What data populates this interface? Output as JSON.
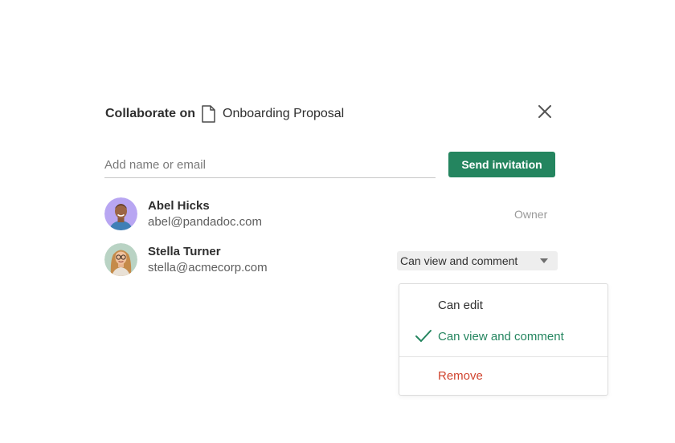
{
  "dialog": {
    "title_prefix": "Collaborate on",
    "document_icon": "document-icon",
    "document_name": "Onboarding Proposal",
    "close_icon": "close-icon"
  },
  "invite": {
    "placeholder": "Add name or email",
    "value": "",
    "send_label": "Send invitation",
    "accent_color": "#24855f"
  },
  "collaborators": [
    {
      "name": "Abel Hicks",
      "email": "abel@pandadoc.com",
      "role": "Owner",
      "avatar_bg": "#b8a6f2"
    },
    {
      "name": "Stella Turner",
      "email": "stella@acmecorp.com",
      "permission": "Can view and comment",
      "avatar_bg": "#b9d3c4"
    }
  ],
  "permission_menu": {
    "items": [
      {
        "label": "Can edit",
        "selected": false
      },
      {
        "label": "Can view and comment",
        "selected": true,
        "icon": "check-icon"
      }
    ],
    "remove_label": "Remove",
    "remove_color": "#d0432e"
  }
}
